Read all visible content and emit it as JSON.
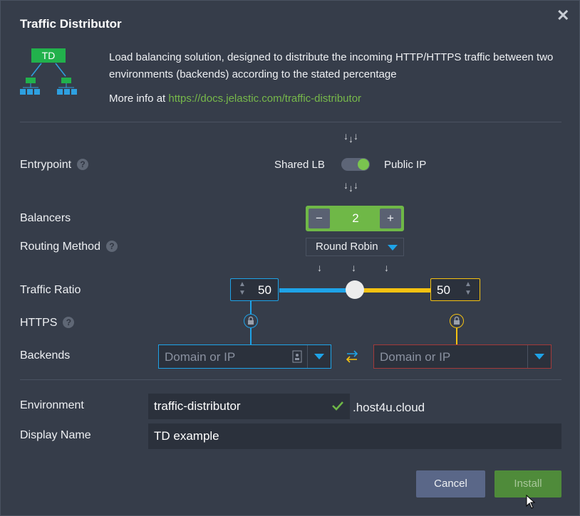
{
  "dialog": {
    "title": "Traffic Distributor",
    "close_label": "✕",
    "logo_text": "TD",
    "description": "Load balancing solution, designed to distribute the incoming HTTP/HTTPS traffic between two environments (backends) according to the stated percentage",
    "more_info_prefix": "More info at ",
    "more_info_link": "https://docs.jelastic.com/traffic-distributor"
  },
  "entrypoint": {
    "label": "Entrypoint",
    "help": "?",
    "left": "Shared LB",
    "right": "Public IP",
    "enabled": true
  },
  "balancers": {
    "label": "Balancers",
    "minus": "−",
    "plus": "+",
    "value": "2"
  },
  "routing": {
    "label": "Routing Method",
    "help": "?",
    "value": "Round Robin"
  },
  "traffic": {
    "label": "Traffic Ratio",
    "left": "50",
    "right": "50",
    "ratio": 0.5
  },
  "https": {
    "label": "HTTPS",
    "help": "?"
  },
  "backends": {
    "label": "Backends",
    "left_placeholder": "Domain or IP",
    "right_placeholder": "Domain or IP"
  },
  "environment": {
    "label": "Environment",
    "value": "traffic-distributor",
    "suffix": ".host4u.cloud"
  },
  "display_name": {
    "label": "Display Name",
    "value": "TD example"
  },
  "buttons": {
    "cancel": "Cancel",
    "install": "Install"
  },
  "colors": {
    "accent_green": "#6fb847",
    "blue": "#1ea3e8",
    "yellow": "#f5c211",
    "red_border": "#a33a3a"
  }
}
